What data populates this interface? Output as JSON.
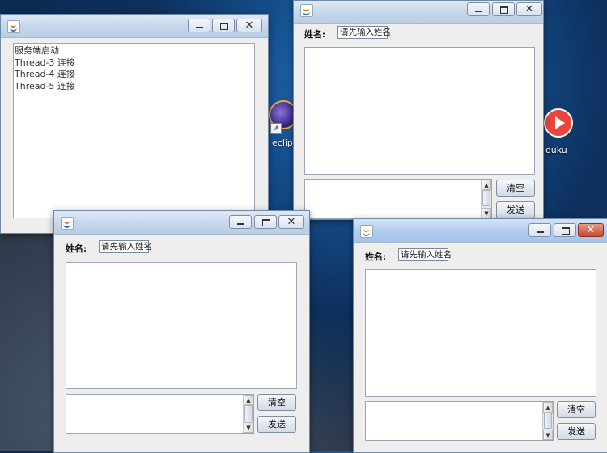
{
  "desktop": {
    "eclipse_label": "eclip",
    "youku_label": "ouku"
  },
  "server_window": {
    "log_lines": [
      "服务端启动",
      "Thread-3 连接",
      "Thread-4 连接",
      "Thread-5 连接"
    ]
  },
  "client_window": {
    "name_label": "姓名:",
    "name_placeholder": "请先输入姓名",
    "clear_button": "清空",
    "send_button": "发送"
  },
  "window_controls": {
    "close": "✕"
  },
  "colors": {
    "active_close": "#c9472c"
  }
}
